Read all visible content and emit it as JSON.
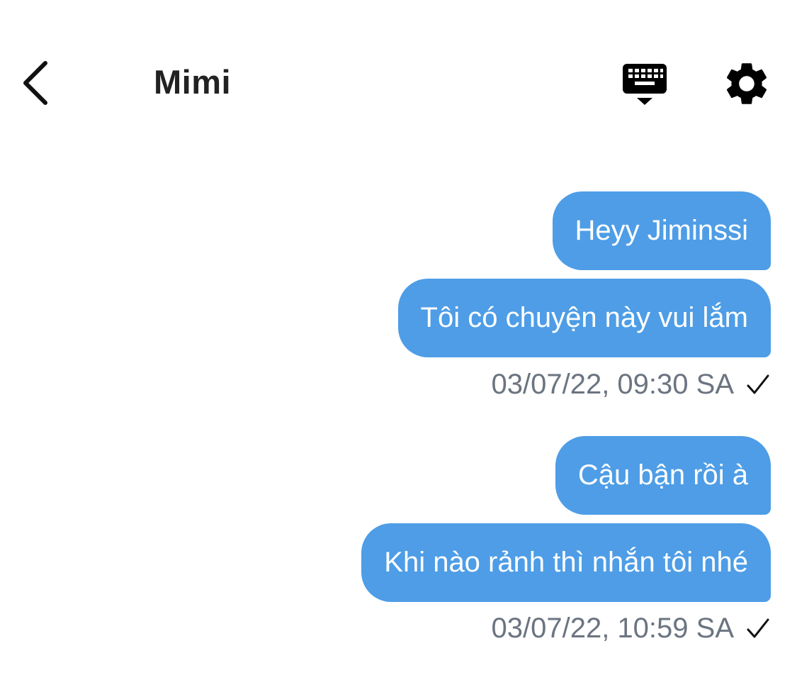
{
  "header": {
    "title": "Mimi",
    "back_icon": "chevron-left-icon",
    "keyboard_icon": "keyboard-hide-icon",
    "settings_icon": "gear-icon"
  },
  "messages": [
    {
      "text": "Heyy Jiminssi"
    },
    {
      "text": "Tôi có chuyện này vui lắm"
    },
    {
      "text": "Cậu bận rồi à"
    },
    {
      "text": "Khi nào rảnh thì nhắn tôi nhé"
    }
  ],
  "timestamps": [
    {
      "text": "03/07/22, 09:30 SA",
      "status_icon": "checkmark-icon"
    },
    {
      "text": "03/07/22, 10:59 SA",
      "status_icon": "checkmark-icon"
    }
  ],
  "colors": {
    "bubble": "#4e9de6",
    "bubble_text": "#ffffff",
    "timestamp": "#6b7480",
    "title": "#222222"
  }
}
